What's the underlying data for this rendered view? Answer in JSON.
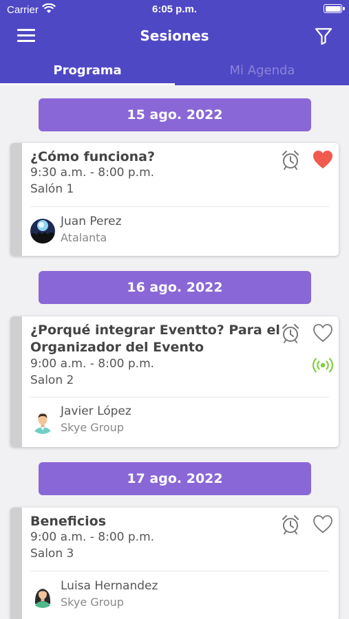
{
  "status_bar": {
    "carrier": "Carrier",
    "time": "6:05 p.m."
  },
  "nav": {
    "title": "Sesiones"
  },
  "tabs": [
    {
      "label": "Programa",
      "active": true
    },
    {
      "label": "Mi Agenda",
      "active": false
    }
  ],
  "colors": {
    "header": "#4f48c5",
    "date_banner": "#8a67d6",
    "favorite_heart": "#f05a4f",
    "live": "#7ad03c"
  },
  "days": [
    {
      "date": "15 ago. 2022",
      "session": {
        "title_lines": [
          "¿Cómo funciona?"
        ],
        "time": "9:30 a.m. - 8:00 p.m.",
        "room": "Salón 1",
        "favorite": true,
        "live": false,
        "speaker": {
          "name": "Juan Perez",
          "org": "Atalanta",
          "avatar_icon": "crowd-photo"
        }
      }
    },
    {
      "date": "16 ago. 2022",
      "session": {
        "title_lines": [
          "¿Porqué integrar Eventto? Para el",
          "Organizador del Evento"
        ],
        "time": "9:00 a.m. - 8:00 p.m.",
        "room": "Salon 2",
        "favorite": false,
        "live": true,
        "speaker": {
          "name": "Javier López",
          "org": "Skye Group",
          "avatar_icon": "man-avatar"
        }
      }
    },
    {
      "date": "17 ago. 2022",
      "session": {
        "title_lines": [
          "Beneficios"
        ],
        "time": "9:00 a.m. - 8:00 p.m.",
        "room": "Salon 3",
        "favorite": false,
        "live": false,
        "speaker": {
          "name": "Luisa Hernandez",
          "org": "Skye Group",
          "avatar_icon": "woman-avatar"
        }
      }
    }
  ]
}
